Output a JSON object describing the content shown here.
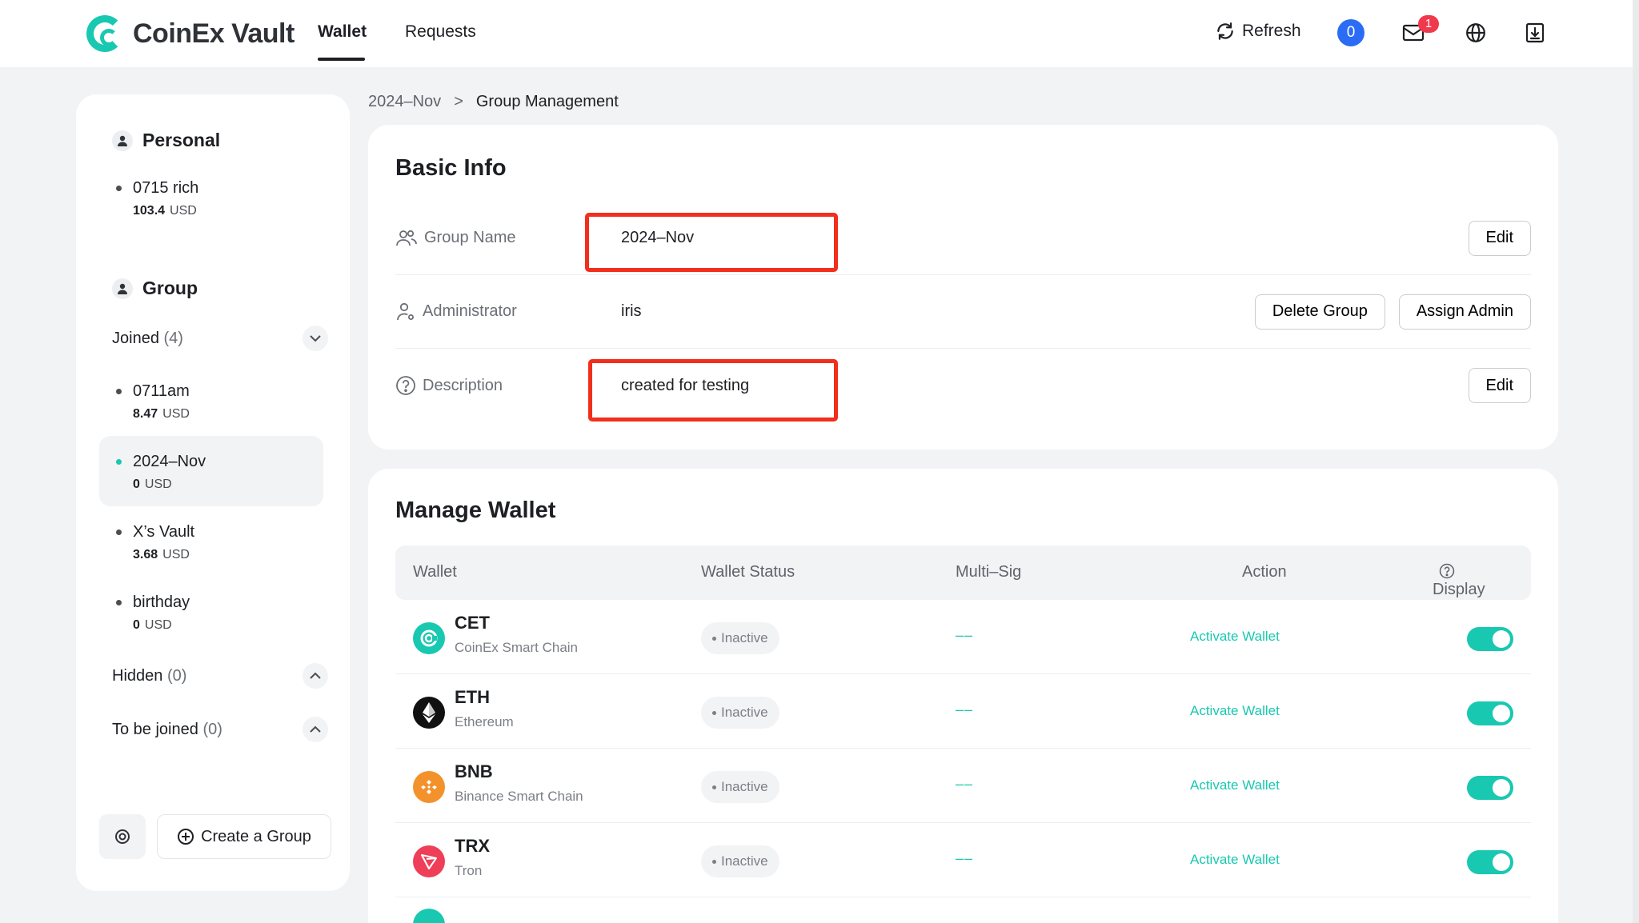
{
  "header": {
    "brand": "CoinEx Vault",
    "tabs": [
      "Wallet",
      "Requests"
    ],
    "refresh_label": "Refresh",
    "pending_count": "0",
    "mail_count": "1"
  },
  "sidebar": {
    "personal_title": "Personal",
    "personal_accounts": [
      {
        "name": "0715 rich",
        "amount": "103.4",
        "unit": "USD"
      }
    ],
    "group_title": "Group",
    "joined_label": "Joined",
    "joined_count": "(4)",
    "joined_accounts": [
      {
        "name": "0711am",
        "amount": "8.47",
        "unit": "USD"
      },
      {
        "name": "2024–Nov",
        "amount": "0",
        "unit": "USD"
      },
      {
        "name": "X’s Vault",
        "amount": "3.68",
        "unit": "USD"
      },
      {
        "name": "birthday",
        "amount": "0",
        "unit": "USD"
      }
    ],
    "hidden_label": "Hidden",
    "hidden_count": "(0)",
    "tobejoined_label": "To be joined",
    "tobejoined_count": "(0)",
    "create_label": "Create a Group"
  },
  "breadcrumb": {
    "parent": "2024–Nov",
    "separator": ">",
    "current": "Group Management"
  },
  "basic_info": {
    "title": "Basic Info",
    "group_name_label": "Group Name",
    "group_name_value": "2024–Nov",
    "admin_label": "Administrator",
    "admin_value": "iris",
    "description_label": "Description",
    "description_value": "created for testing",
    "edit_label": "Edit",
    "delete_group_label": "Delete Group",
    "assign_admin_label": "Assign Admin"
  },
  "manage_wallet": {
    "title": "Manage Wallet",
    "columns": [
      "Wallet",
      "Wallet Status",
      "Multi–Sig",
      "Action",
      "Display"
    ],
    "rows": [
      {
        "symbol": "CET",
        "chain": "CoinEx Smart Chain",
        "status": "Inactive",
        "multisig": "––",
        "action": "Activate Wallet",
        "display": true,
        "icon": "cet-icon",
        "color": "#19c8b0"
      },
      {
        "symbol": "ETH",
        "chain": "Ethereum",
        "status": "Inactive",
        "multisig": "––",
        "action": "Activate Wallet",
        "display": true,
        "icon": "eth-icon",
        "color": "#111111"
      },
      {
        "symbol": "BNB",
        "chain": "Binance Smart Chain",
        "status": "Inactive",
        "multisig": "––",
        "action": "Activate Wallet",
        "display": true,
        "icon": "bnb-icon",
        "color": "#f3912b"
      },
      {
        "symbol": "TRX",
        "chain": "Tron",
        "status": "Inactive",
        "multisig": "––",
        "action": "Activate Wallet",
        "display": true,
        "icon": "trx-icon",
        "color": "#ef3e57"
      }
    ]
  },
  "colors": {
    "accent": "#19c8b0",
    "highlight": "#f22e1d",
    "badge_blue": "#2b6cf6",
    "badge_red": "#f0394c"
  }
}
